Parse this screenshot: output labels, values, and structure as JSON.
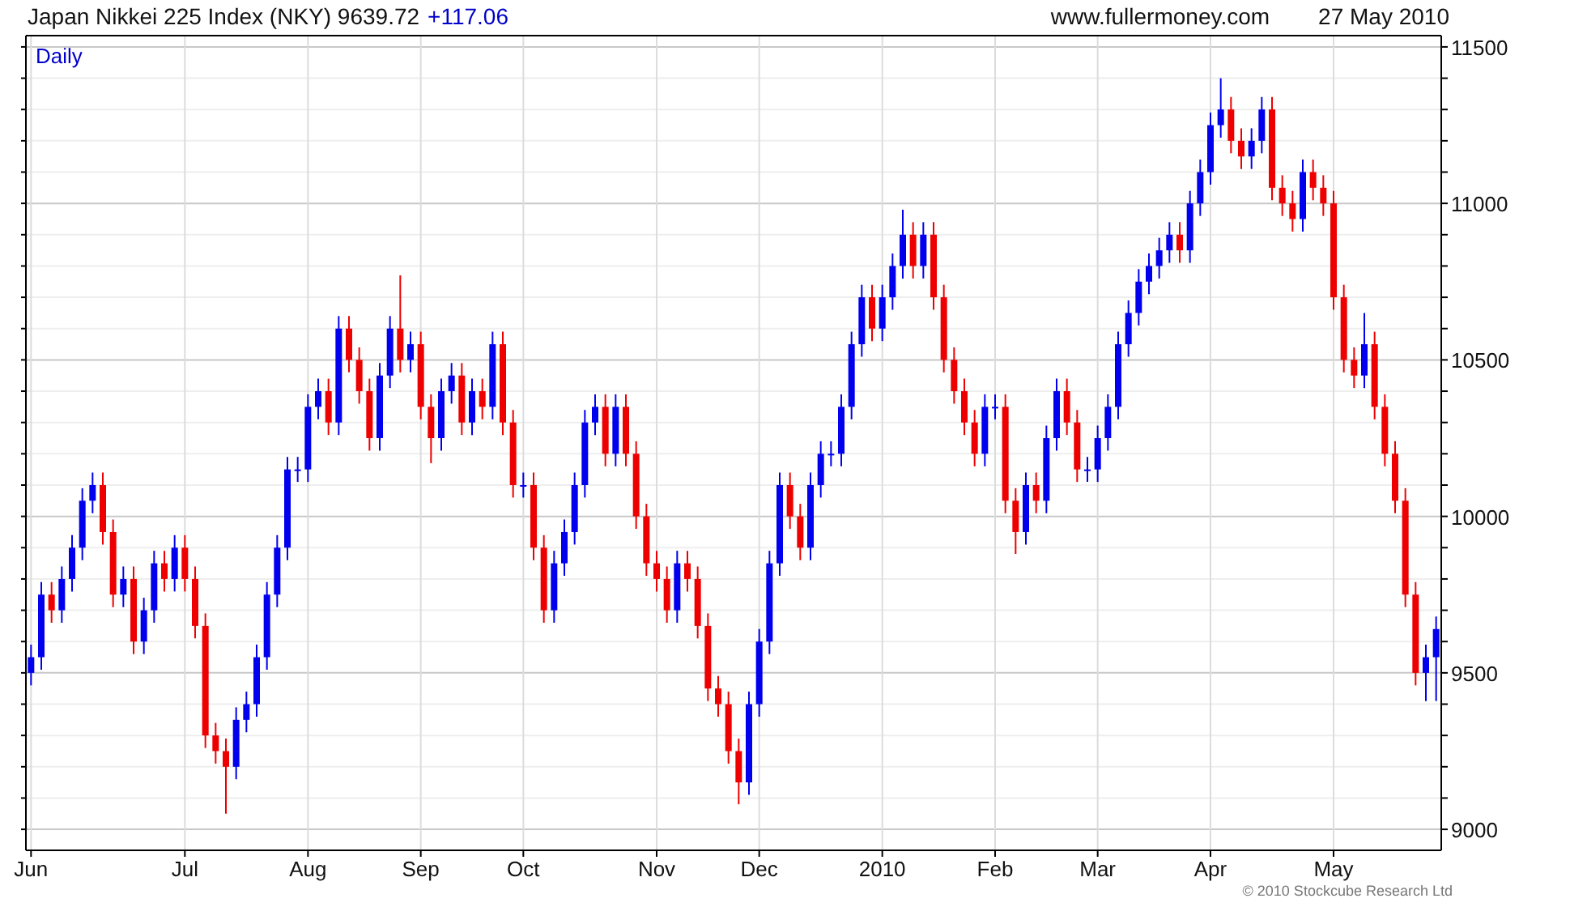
{
  "header": {
    "title": "Japan Nikkei 225 Index (NKY) 9639.72",
    "change": "+117.06",
    "website": "www.fullermoney.com",
    "date": "27 May 2010"
  },
  "chart": {
    "chart_data": {
      "type": "candlestick",
      "title": "Daily",
      "grid": true,
      "ylim": [
        8933,
        11536
      ],
      "categories": [
        "Jun",
        null,
        null,
        null,
        null,
        null,
        null,
        null,
        null,
        null,
        null,
        null,
        null,
        null,
        null,
        "Jul",
        null,
        null,
        null,
        null,
        null,
        null,
        null,
        null,
        null,
        null,
        null,
        "Aug",
        null,
        null,
        null,
        null,
        null,
        null,
        null,
        null,
        null,
        null,
        "Sep",
        null,
        null,
        null,
        null,
        null,
        null,
        null,
        null,
        null,
        "Oct",
        null,
        null,
        null,
        null,
        null,
        null,
        null,
        null,
        null,
        null,
        null,
        null,
        "Nov",
        null,
        null,
        null,
        null,
        null,
        null,
        null,
        null,
        null,
        "Dec",
        null,
        null,
        null,
        null,
        null,
        null,
        null,
        null,
        null,
        null,
        null,
        "2010",
        null,
        null,
        null,
        null,
        null,
        null,
        null,
        null,
        null,
        null,
        "Feb",
        null,
        null,
        null,
        null,
        null,
        null,
        null,
        null,
        null,
        "Mar",
        null,
        null,
        null,
        null,
        null,
        null,
        null,
        null,
        null,
        null,
        "Apr",
        null,
        null,
        null,
        null,
        null,
        null,
        null,
        null,
        null,
        null,
        null,
        "May",
        null,
        null,
        null,
        null,
        null,
        null,
        null,
        null,
        null,
        null
      ],
      "yticks": [
        9000,
        9500,
        10000,
        10500,
        11000,
        11500
      ],
      "ohlc": [
        [
          9500,
          9590,
          9460,
          9550
        ],
        [
          9550,
          9790,
          9510,
          9750
        ],
        [
          9750,
          9790,
          9660,
          9700
        ],
        [
          9700,
          9840,
          9660,
          9800
        ],
        [
          9800,
          9940,
          9760,
          9900
        ],
        [
          9900,
          10090,
          9860,
          10050
        ],
        [
          10050,
          10140,
          10010,
          10100
        ],
        [
          10100,
          10140,
          9910,
          9950
        ],
        [
          9950,
          9990,
          9710,
          9750
        ],
        [
          9750,
          9840,
          9710,
          9800
        ],
        [
          9800,
          9840,
          9560,
          9600
        ],
        [
          9600,
          9740,
          9560,
          9700
        ],
        [
          9700,
          9890,
          9660,
          9850
        ],
        [
          9850,
          9890,
          9760,
          9800
        ],
        [
          9800,
          9940,
          9760,
          9900
        ],
        [
          9900,
          9940,
          9760,
          9800
        ],
        [
          9800,
          9840,
          9610,
          9650
        ],
        [
          9650,
          9690,
          9260,
          9300
        ],
        [
          9300,
          9340,
          9210,
          9250
        ],
        [
          9250,
          9290,
          9050,
          9200
        ],
        [
          9200,
          9390,
          9160,
          9350
        ],
        [
          9350,
          9440,
          9310,
          9400
        ],
        [
          9400,
          9590,
          9360,
          9550
        ],
        [
          9550,
          9790,
          9510,
          9750
        ],
        [
          9750,
          9940,
          9710,
          9900
        ],
        [
          9900,
          10190,
          9860,
          10150
        ],
        [
          10150,
          10190,
          10110,
          10150
        ],
        [
          10150,
          10390,
          10110,
          10350
        ],
        [
          10350,
          10440,
          10310,
          10400
        ],
        [
          10400,
          10440,
          10260,
          10300
        ],
        [
          10300,
          10640,
          10260,
          10600
        ],
        [
          10600,
          10640,
          10460,
          10500
        ],
        [
          10500,
          10540,
          10360,
          10400
        ],
        [
          10400,
          10440,
          10210,
          10250
        ],
        [
          10250,
          10490,
          10210,
          10450
        ],
        [
          10450,
          10640,
          10410,
          10600
        ],
        [
          10600,
          10770,
          10460,
          10500
        ],
        [
          10500,
          10590,
          10460,
          10550
        ],
        [
          10550,
          10590,
          10310,
          10350
        ],
        [
          10350,
          10390,
          10170,
          10250
        ],
        [
          10250,
          10440,
          10210,
          10400
        ],
        [
          10400,
          10490,
          10360,
          10450
        ],
        [
          10450,
          10490,
          10260,
          10300
        ],
        [
          10300,
          10440,
          10260,
          10400
        ],
        [
          10400,
          10440,
          10310,
          10350
        ],
        [
          10350,
          10590,
          10310,
          10550
        ],
        [
          10550,
          10590,
          10260,
          10300
        ],
        [
          10300,
          10340,
          10060,
          10100
        ],
        [
          10100,
          10140,
          10060,
          10100
        ],
        [
          10100,
          10140,
          9860,
          9900
        ],
        [
          9900,
          9940,
          9660,
          9700
        ],
        [
          9700,
          9890,
          9660,
          9850
        ],
        [
          9850,
          9990,
          9810,
          9950
        ],
        [
          9950,
          10140,
          9910,
          10100
        ],
        [
          10100,
          10340,
          10060,
          10300
        ],
        [
          10300,
          10390,
          10260,
          10350
        ],
        [
          10350,
          10390,
          10160,
          10200
        ],
        [
          10200,
          10390,
          10160,
          10350
        ],
        [
          10350,
          10390,
          10160,
          10200
        ],
        [
          10200,
          10240,
          9960,
          10000
        ],
        [
          10000,
          10040,
          9810,
          9850
        ],
        [
          9850,
          9890,
          9760,
          9800
        ],
        [
          9800,
          9840,
          9660,
          9700
        ],
        [
          9700,
          9890,
          9660,
          9850
        ],
        [
          9850,
          9890,
          9760,
          9800
        ],
        [
          9800,
          9840,
          9610,
          9650
        ],
        [
          9650,
          9690,
          9410,
          9450
        ],
        [
          9450,
          9490,
          9360,
          9400
        ],
        [
          9400,
          9440,
          9210,
          9250
        ],
        [
          9250,
          9290,
          9080,
          9150
        ],
        [
          9150,
          9440,
          9110,
          9400
        ],
        [
          9400,
          9640,
          9360,
          9600
        ],
        [
          9600,
          9890,
          9560,
          9850
        ],
        [
          9850,
          10140,
          9810,
          10100
        ],
        [
          10100,
          10140,
          9960,
          10000
        ],
        [
          10000,
          10040,
          9860,
          9900
        ],
        [
          9900,
          10140,
          9860,
          10100
        ],
        [
          10100,
          10240,
          10060,
          10200
        ],
        [
          10200,
          10240,
          10160,
          10200
        ],
        [
          10200,
          10390,
          10160,
          10350
        ],
        [
          10350,
          10590,
          10310,
          10550
        ],
        [
          10550,
          10740,
          10510,
          10700
        ],
        [
          10700,
          10740,
          10560,
          10600
        ],
        [
          10600,
          10740,
          10560,
          10700
        ],
        [
          10700,
          10840,
          10660,
          10800
        ],
        [
          10800,
          10980,
          10760,
          10900
        ],
        [
          10900,
          10940,
          10760,
          10800
        ],
        [
          10800,
          10940,
          10760,
          10900
        ],
        [
          10900,
          10940,
          10660,
          10700
        ],
        [
          10700,
          10740,
          10460,
          10500
        ],
        [
          10500,
          10540,
          10360,
          10400
        ],
        [
          10400,
          10440,
          10260,
          10300
        ],
        [
          10300,
          10340,
          10160,
          10200
        ],
        [
          10200,
          10390,
          10160,
          10350
        ],
        [
          10350,
          10390,
          10310,
          10350
        ],
        [
          10350,
          10390,
          10010,
          10050
        ],
        [
          10050,
          10090,
          9880,
          9950
        ],
        [
          9950,
          10140,
          9910,
          10100
        ],
        [
          10100,
          10140,
          10010,
          10050
        ],
        [
          10050,
          10290,
          10010,
          10250
        ],
        [
          10250,
          10440,
          10210,
          10400
        ],
        [
          10400,
          10440,
          10260,
          10300
        ],
        [
          10300,
          10340,
          10110,
          10150
        ],
        [
          10150,
          10190,
          10110,
          10150
        ],
        [
          10150,
          10290,
          10110,
          10250
        ],
        [
          10250,
          10390,
          10210,
          10350
        ],
        [
          10350,
          10590,
          10310,
          10550
        ],
        [
          10550,
          10690,
          10510,
          10650
        ],
        [
          10650,
          10790,
          10610,
          10750
        ],
        [
          10750,
          10840,
          10710,
          10800
        ],
        [
          10800,
          10890,
          10760,
          10850
        ],
        [
          10850,
          10940,
          10810,
          10900
        ],
        [
          10900,
          10940,
          10810,
          10850
        ],
        [
          10850,
          11040,
          10810,
          11000
        ],
        [
          11000,
          11140,
          10960,
          11100
        ],
        [
          11100,
          11290,
          11060,
          11250
        ],
        [
          11250,
          11400,
          11210,
          11300
        ],
        [
          11300,
          11340,
          11160,
          11200
        ],
        [
          11200,
          11240,
          11110,
          11150
        ],
        [
          11150,
          11240,
          11110,
          11200
        ],
        [
          11200,
          11340,
          11160,
          11300
        ],
        [
          11300,
          11340,
          11010,
          11050
        ],
        [
          11050,
          11090,
          10960,
          11000
        ],
        [
          11000,
          11040,
          10910,
          10950
        ],
        [
          10950,
          11140,
          10910,
          11100
        ],
        [
          11100,
          11140,
          11010,
          11050
        ],
        [
          11050,
          11090,
          10960,
          11000
        ],
        [
          11000,
          11040,
          10660,
          10700
        ],
        [
          10700,
          10740,
          10460,
          10500
        ],
        [
          10500,
          10540,
          10410,
          10450
        ],
        [
          10450,
          10650,
          10410,
          10550
        ],
        [
          10550,
          10590,
          10310,
          10350
        ],
        [
          10350,
          10390,
          10160,
          10200
        ],
        [
          10200,
          10240,
          10010,
          10050
        ],
        [
          10050,
          10090,
          9710,
          9750
        ],
        [
          9750,
          9790,
          9460,
          9500
        ],
        [
          9500,
          9590,
          9410,
          9550
        ],
        [
          9550,
          9680,
          9410,
          9640
        ]
      ]
    }
  },
  "footer": {
    "copyright": "© 2010 Stockcube Research Ltd"
  }
}
